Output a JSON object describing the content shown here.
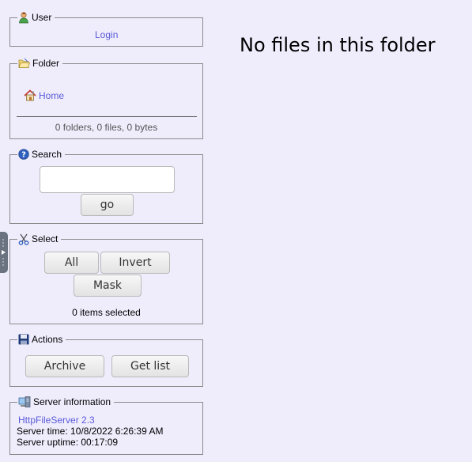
{
  "user": {
    "legend": "User",
    "login_link": "Login"
  },
  "folder": {
    "legend": "Folder",
    "home_link": "Home",
    "summary": "0 folders, 0 files, 0 bytes"
  },
  "search": {
    "legend": "Search",
    "input_value": "",
    "go_label": "go"
  },
  "select": {
    "legend": "Select",
    "all_label": "All",
    "invert_label": "Invert",
    "mask_label": "Mask",
    "status": "0 items selected"
  },
  "actions": {
    "legend": "Actions",
    "archive_label": "Archive",
    "getlist_label": "Get list"
  },
  "server": {
    "legend": "Server information",
    "product_link": "HttpFileServer 2.3",
    "time": "Server time: 10/8/2022 6:26:39 AM",
    "uptime": "Server uptime: 00:17:09"
  },
  "main": {
    "empty_message": "No files in this folder"
  },
  "colors": {
    "background": "#efedfc",
    "link": "#5a5ad8",
    "border": "#8a8a8a"
  },
  "icons": [
    "user-icon",
    "folder-icon",
    "home-icon",
    "help-icon",
    "scissors-icon",
    "save-icon",
    "server-icon",
    "expand-handle-icon"
  ]
}
